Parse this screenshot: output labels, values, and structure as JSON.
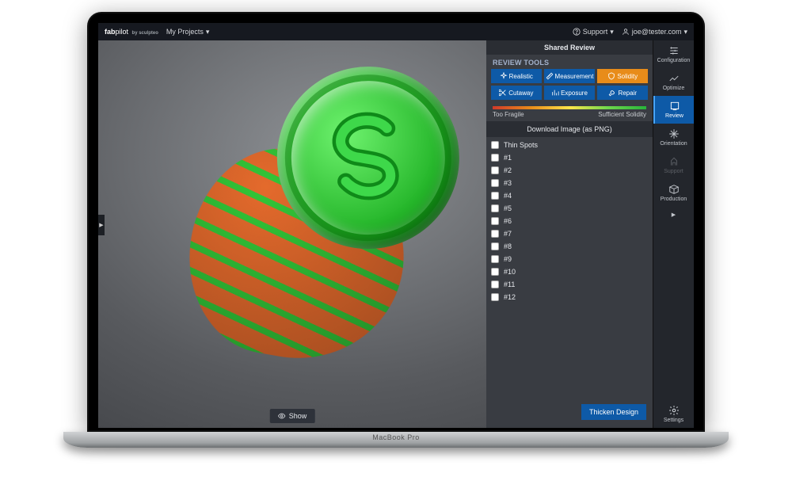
{
  "device": {
    "label": "MacBook Pro"
  },
  "topbar": {
    "logo_bold": "fab",
    "logo_thin": "pilot",
    "logo_sub": "by sculpteo",
    "projects_label": "My Projects",
    "support_label": "Support",
    "user_email": "joe@tester.com"
  },
  "panel": {
    "header": "Shared Review",
    "tools_label": "REVIEW TOOLS",
    "tools": [
      {
        "label": "Realistic",
        "active": false,
        "icon": "sparkle"
      },
      {
        "label": "Measurement",
        "active": false,
        "icon": "ruler"
      },
      {
        "label": "Solidity",
        "active": true,
        "icon": "shield"
      },
      {
        "label": "Cutaway",
        "active": false,
        "icon": "scissors"
      },
      {
        "label": "Exposure",
        "active": false,
        "icon": "bars"
      },
      {
        "label": "Repair",
        "active": false,
        "icon": "wrench"
      }
    ],
    "scale_low": "Too Fragile",
    "scale_high": "Sufficient Solidity",
    "download_label": "Download Image (as PNG)",
    "list_title": "Thin Spots",
    "items": [
      "#1",
      "#2",
      "#3",
      "#4",
      "#5",
      "#6",
      "#7",
      "#8",
      "#9",
      "#10",
      "#11",
      "#12"
    ],
    "thicken_label": "Thicken Design"
  },
  "sidebar": {
    "items": [
      {
        "label": "Configuration",
        "name": "configuration",
        "active": false,
        "disabled": false
      },
      {
        "label": "Optimize",
        "name": "optimize",
        "active": false,
        "disabled": false
      },
      {
        "label": "Review",
        "name": "review",
        "active": true,
        "disabled": false
      },
      {
        "label": "Orientation",
        "name": "orientation",
        "active": false,
        "disabled": false
      },
      {
        "label": "Support",
        "name": "support",
        "active": false,
        "disabled": true
      },
      {
        "label": "Production",
        "name": "production",
        "active": false,
        "disabled": false
      }
    ],
    "expand_icon": "▶",
    "settings_label": "Settings"
  },
  "viewport": {
    "show_label": "Show",
    "expand_icon": "▶"
  }
}
